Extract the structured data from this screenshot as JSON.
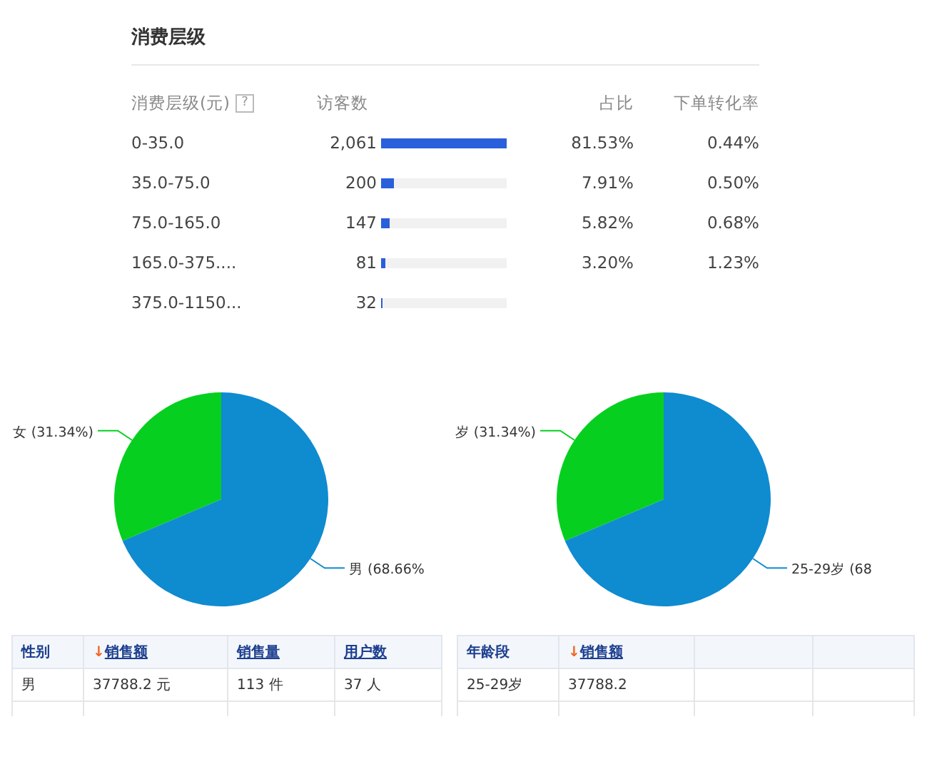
{
  "section": {
    "title": "消费层级"
  },
  "level_table": {
    "columns": [
      {
        "label": "消费层级(元)",
        "help_icon": "?"
      },
      {
        "label": "访客数"
      },
      {
        "label": "占比"
      },
      {
        "label": "下单转化率"
      }
    ],
    "rows": [
      {
        "range": "0-35.0",
        "visitors": "2,061",
        "level": 1.0,
        "share": "81.53%",
        "conversion": "0.44%"
      },
      {
        "range": "35.0-75.0",
        "visitors": "200",
        "level": 0.097,
        "share": "7.91%",
        "conversion": "0.50%"
      },
      {
        "range": "75.0-165.0",
        "visitors": "147",
        "level": 0.071,
        "share": "5.82%",
        "conversion": "0.68%"
      },
      {
        "range": "165.0-375....",
        "visitors": "81",
        "level": 0.039,
        "share": "3.20%",
        "conversion": "1.23%"
      },
      {
        "range": "375.0-1150...",
        "visitors": "32",
        "level": 0.016
      }
    ]
  },
  "pies": [
    {
      "chart_data": {
        "type": "pie",
        "categories": [
          "女 (31.34%)",
          "男 (68.66%"
        ],
        "values": [
          31.34,
          68.66
        ],
        "colors": [
          "#07cf1f",
          "#0f8bd0"
        ]
      }
    },
    {
      "chart_data": {
        "type": "pie",
        "categories": [
          "岁 (31.34%)",
          "25-29岁 (68"
        ],
        "values": [
          31.34,
          68.66
        ],
        "colors": [
          "#07cf1f",
          "#0f8bd0"
        ]
      }
    }
  ],
  "tables": [
    {
      "columns": [
        {
          "label": "性别",
          "link": false
        },
        {
          "label": "销售额",
          "sort_icon": "↓",
          "link": true
        },
        {
          "label": "销售量",
          "link": true
        },
        {
          "label": "用户数",
          "link": true
        }
      ],
      "rows": [
        [
          "男",
          "37788.2 元",
          "113 件",
          "37 人"
        ]
      ]
    },
    {
      "columns": [
        {
          "label": "年龄段",
          "link": false
        },
        {
          "label": "销售额",
          "sort_icon": "↓",
          "link": true
        }
      ],
      "rows": [
        [
          "25-29岁",
          "37788.2"
        ]
      ]
    }
  ]
}
